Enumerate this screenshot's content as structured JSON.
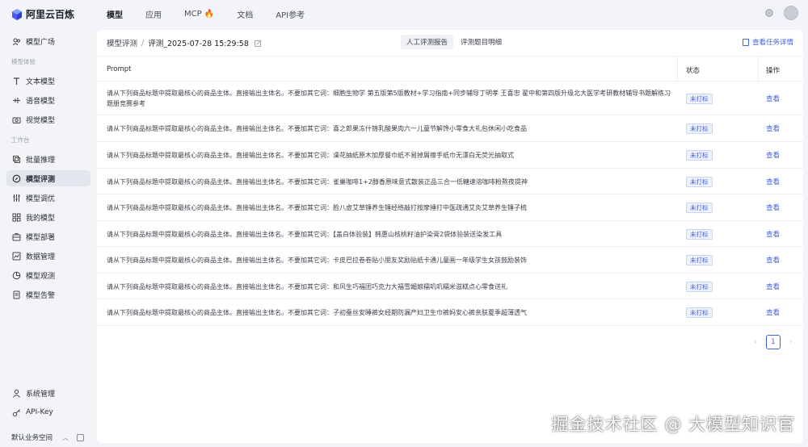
{
  "brand": {
    "name": "阿里云百炼"
  },
  "topnav": [
    {
      "label": "模型"
    },
    {
      "label": "应用"
    },
    {
      "label": "MCP 🔥"
    },
    {
      "label": "文档"
    },
    {
      "label": "API参考"
    }
  ],
  "sidebar": {
    "model_square": "模型广场",
    "group_experience": "模型体验",
    "text_model": "文本模型",
    "voice_model": "语音模型",
    "vision_model": "视觉模型",
    "group_workbench": "工作台",
    "batch_inference": "批量推理",
    "model_eval": "模型评测",
    "model_tuning": "模型调优",
    "my_models": "我的模型",
    "model_deploy": "模型部署",
    "data_manage": "数据管理",
    "model_observe": "模型观测",
    "model_alert": "模型告警",
    "system_manage": "系统管理",
    "api_key": "API-Key",
    "workspace": "默认业务空间"
  },
  "header": {
    "crumb_parent": "模型评测",
    "crumb_sep": "/",
    "crumb_current": "评测_2025-07-28 15:29:58",
    "tabs": [
      "人工评测报告",
      "评测题目明细"
    ],
    "detail_link": "查看任务详情"
  },
  "table": {
    "columns": {
      "prompt": "Prompt",
      "status": "状态",
      "action": "操作"
    },
    "rows": [
      {
        "prompt": "请从下列商品标题中提取最核心的商品主体。直接输出主体名。不要加其它词：细胞生物学 第五版第5版教材+学习指南+同步辅导丁明孝 王喜忠 翟中和第四版升级北大医学考研教材辅导书题解练习题册竞赛参考",
        "status": "未打标",
        "action": "查看"
      },
      {
        "prompt": "请从下列商品标题中提取最核心的商品主体。直接输出主体名。不要加其它词：喜之郎果冻什锦乳酸果肉六一儿童节解馋小零食大礼包休闲小吃食品",
        "status": "未打标",
        "action": "查看"
      },
      {
        "prompt": "请从下列商品标题中提取最核心的商品主体。直接输出主体名。不要加其它词：澡花抽纸原木加厚餐巾纸不易掉屑擦手纸巾无漂白无荧光抽取式",
        "status": "未打标",
        "action": "查看"
      },
      {
        "prompt": "请从下列商品标题中提取最核心的商品主体。直接输出主体名。不要加其它词：雀巢咖啡1+2醇香原味意式散装正品三合一低糖速溶咖啡粉熬夜提神",
        "status": "未打标",
        "action": "查看"
      },
      {
        "prompt": "请从下列商品标题中提取最核心的商品主体。直接输出主体名。不要加其它词：脸八虚艾草锤养生锤经络敲打按摩捶打中医疏通艾灸艾草养生锤子梳",
        "status": "未打标",
        "action": "查看"
      },
      {
        "prompt": "请从下列商品标题中提取最核心的商品主体。直接输出主体名。不要加其它词：【盖白体验装】韩惠山核桃籽油护染膏2袋体验装送染发工具",
        "status": "未打标",
        "action": "查看"
      },
      {
        "prompt": "请从下列商品标题中提取最核心的商品主体。直接输出主体名。不要加其它词：卡皮巴拉卷卷贴小朋友奖励贴纸卡通儿童画一年级学生女孩鼓励装饰",
        "status": "未打标",
        "action": "查看"
      },
      {
        "prompt": "请从下列商品标题中提取最核心的商品主体。直接输出主体名。不要加其它词：和风生巧福团巧克力大福雪媚娘糯叽叽糯米滋糕点心零食送礼",
        "status": "未打标",
        "action": "查看"
      },
      {
        "prompt": "请从下列商品标题中提取最核心的商品主体。直接输出主体名。不要加其它词：子初蚕丝安睡裤女经期防漏产妇卫生巾裤妈安心裤亲肤夏季超薄透气",
        "status": "未打标",
        "action": "查看"
      }
    ]
  },
  "pagination": {
    "current": "1",
    "prev": "‹",
    "next": "›"
  },
  "watermark": "掘金技术社区 @ 大模型知识官"
}
